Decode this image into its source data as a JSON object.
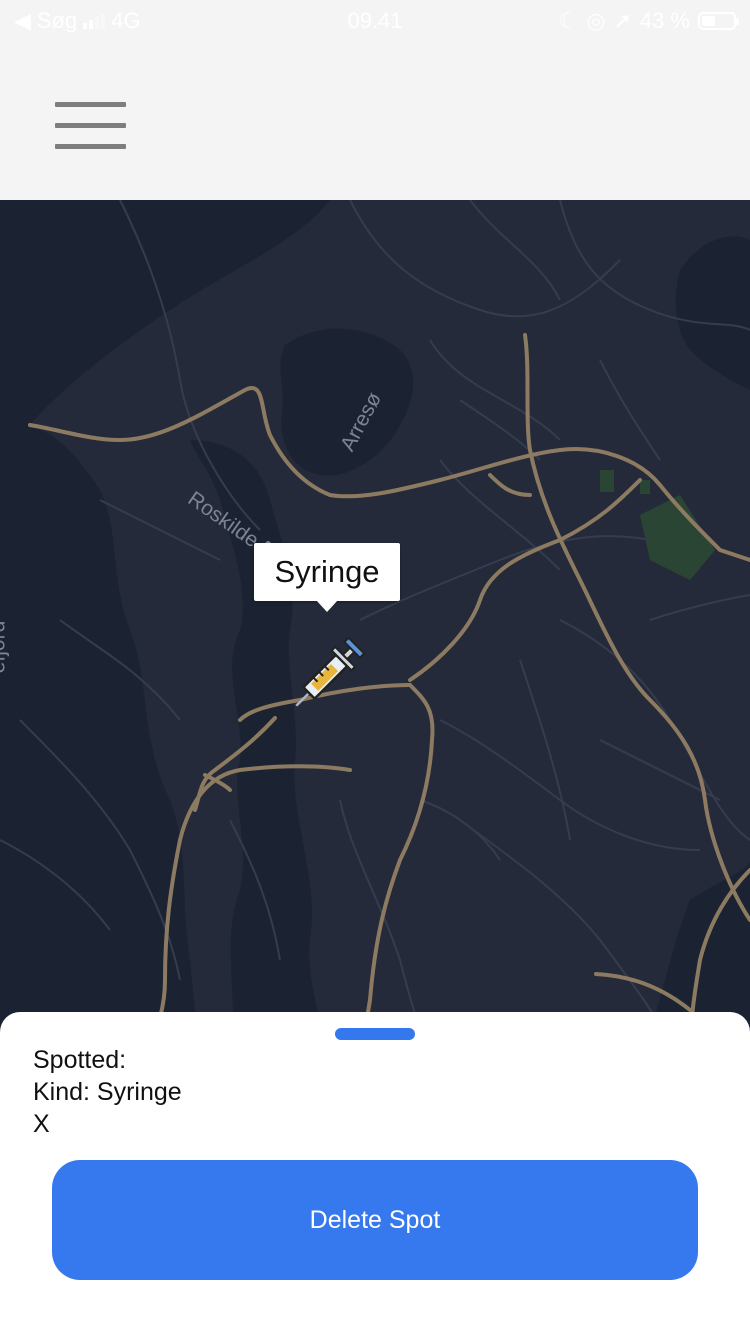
{
  "status_bar": {
    "carrier": "Søg",
    "network": "4G",
    "time": "09.41",
    "battery_percent": "43 %",
    "battery_level": 0.43,
    "icons": [
      "back-arrow-icon",
      "signal-icon",
      "moon-icon",
      "orientation-lock-icon",
      "location-arrow-icon",
      "battery-icon"
    ]
  },
  "header": {
    "menu_icon": "hamburger-menu-icon"
  },
  "map": {
    "theme": "dark",
    "labels": {
      "lake_arreso": "Arresø",
      "fjord_roskilde": "Roskilde f",
      "fjord_left": "efjord"
    },
    "marker": {
      "label": "Syringe",
      "icon": "syringe-icon"
    }
  },
  "sheet": {
    "spotted_label": "Spotted:",
    "kind_text": "Kind: Syringe",
    "extra_text": "X",
    "delete_label": "Delete Spot"
  },
  "colors": {
    "accent": "#3679ee",
    "map_land": "#242a39",
    "map_water": "#1b2333",
    "map_road": "#8d7b61",
    "header_bg": "#f4f4f4"
  }
}
